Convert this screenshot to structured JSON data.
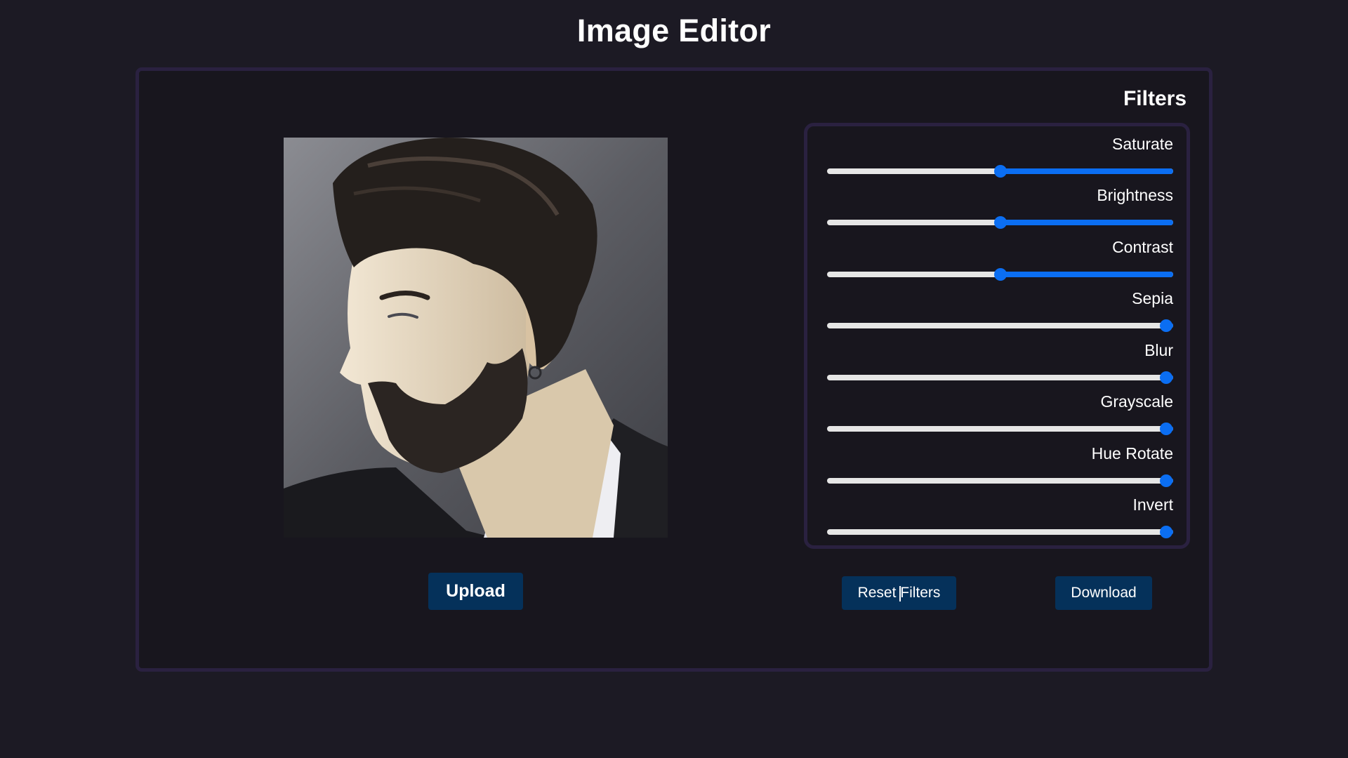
{
  "app": {
    "title": "Image Editor"
  },
  "preview": {
    "image_subject": "portrait photo of a bearded man in profile"
  },
  "filters": {
    "heading": "Filters",
    "accent_color": "#0b6ef2",
    "items": [
      {
        "label": "Saturate",
        "value": 0.5
      },
      {
        "label": "Brightness",
        "value": 0.5
      },
      {
        "label": "Contrast",
        "value": 0.5
      },
      {
        "label": "Sepia",
        "value": 0.98
      },
      {
        "label": "Blur",
        "value": 0.98
      },
      {
        "label": "Grayscale",
        "value": 0.98
      },
      {
        "label": "Hue Rotate",
        "value": 0.98
      },
      {
        "label": "Invert",
        "value": 0.98
      }
    ]
  },
  "actions": {
    "upload_label": "Upload",
    "reset_label": "Reset Filters",
    "download_label": "Download"
  }
}
